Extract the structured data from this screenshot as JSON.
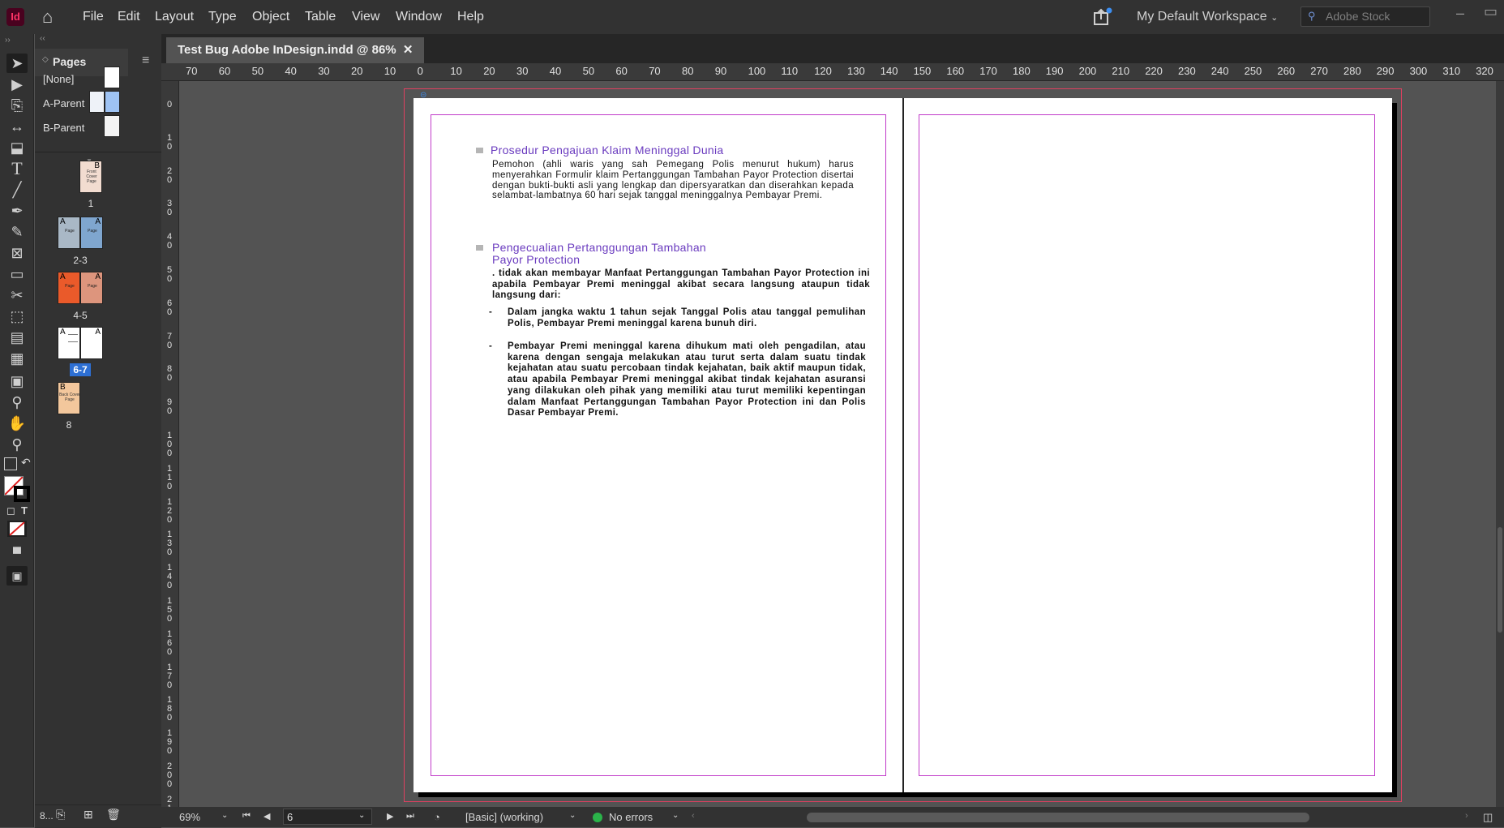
{
  "app": {
    "logo": "Id",
    "home_icon": "home-icon"
  },
  "menu": [
    "File",
    "Edit",
    "Layout",
    "Type",
    "Object",
    "Table",
    "View",
    "Window",
    "Help"
  ],
  "workspace": {
    "label": "My Default Workspace"
  },
  "stock_search": {
    "placeholder": "Adobe Stock"
  },
  "pages_panel": {
    "title": "Pages",
    "parents": [
      {
        "label": "[None]"
      },
      {
        "label": "A-Parent"
      },
      {
        "label": "B-Parent"
      }
    ],
    "thumbs": [
      {
        "label": "1",
        "prefix": "B",
        "caption": "Front Cover Page",
        "color": "#f2dcd0"
      },
      {
        "label": "2-3",
        "prefix": "A",
        "caption": "Page",
        "color": "#9db3c9"
      },
      {
        "label": "4-5",
        "prefix": "A",
        "caption": "Page",
        "color": "#ea6b3d"
      },
      {
        "label": "6-7",
        "prefix": "A",
        "caption": "",
        "color": "#ffffff",
        "selected": true
      },
      {
        "label": "8",
        "prefix": "B",
        "caption": "Back Cover Page",
        "color": "#f3c79c"
      }
    ],
    "footer_count": "8..."
  },
  "document": {
    "tab_title": "Test Bug Adobe InDesign.indd @ 86%",
    "close": "✕"
  },
  "ruler_h": [
    "70",
    "60",
    "50",
    "40",
    "30",
    "20",
    "10",
    "0",
    "10",
    "20",
    "30",
    "40",
    "50",
    "60",
    "70",
    "80",
    "90",
    "100",
    "110",
    "120",
    "130",
    "140",
    "150",
    "160",
    "170",
    "180",
    "190",
    "200",
    "210",
    "220",
    "230",
    "240",
    "250",
    "260",
    "270",
    "280",
    "290",
    "300",
    "310",
    "320"
  ],
  "ruler_v": [
    "0",
    "10",
    "20",
    "30",
    "40",
    "50",
    "60",
    "70",
    "80",
    "90",
    "100",
    "110",
    "120",
    "130",
    "140",
    "150",
    "160",
    "170",
    "180",
    "190",
    "200",
    "210"
  ],
  "page_content": {
    "heading1": "Prosedur Pengajuan Klaim Meninggal Dunia",
    "para1": "Pemohon (ahli waris yang sah Pemegang Polis menurut hukum) harus menyerahkan Formulir klaim Pertanggungan Tambahan Payor Protection disertai dengan bukti-bukti asli yang lengkap dan dipersyaratkan dan diserahkan kepada selambat-lambatnya 60 hari sejak tanggal meninggalnya Pembayar Premi.",
    "heading2_line1": "Pengecualian Pertanggungan Tambahan",
    "heading2_line2": "Payor Protection",
    "para2": ". tidak akan membayar Manfaat Pertanggungan Tambahan Payor Protection ini apabila Pembayar Premi meninggal akibat secara langsung ataupun tidak langsung dari:",
    "bullet1": "Dalam jangka waktu 1 tahun sejak Tanggal Polis atau tanggal pemulihan Polis, Pembayar Premi meninggal karena bunuh diri.",
    "bullet2": "Pembayar Premi meninggal karena dihukum mati oleh pengadilan, atau karena dengan sengaja melakukan atau turut serta dalam suatu tindak kejahatan atau suatu percobaan tindak kejahatan, baik aktif maupun tidak, atau apabila Pembayar Premi meninggal akibat tindak kejahatan asuransi yang dilakukan oleh pihak yang memiliki atau turut memiliki kepentingan dalam Manfaat Pertanggungan Tambahan Payor Protection ini dan Polis Dasar Pembayar Premi.",
    "bullet_marker": "-"
  },
  "status_bar": {
    "zoom": "69%",
    "page": "6",
    "style": "[Basic] (working)",
    "preflight": "No errors",
    "preflight_color": "#2bb34a"
  },
  "colors": {
    "margin": "#c13bc9",
    "bleed": "#e04060",
    "heading": "#6a3bbf",
    "selection": "#2d6fd3"
  }
}
